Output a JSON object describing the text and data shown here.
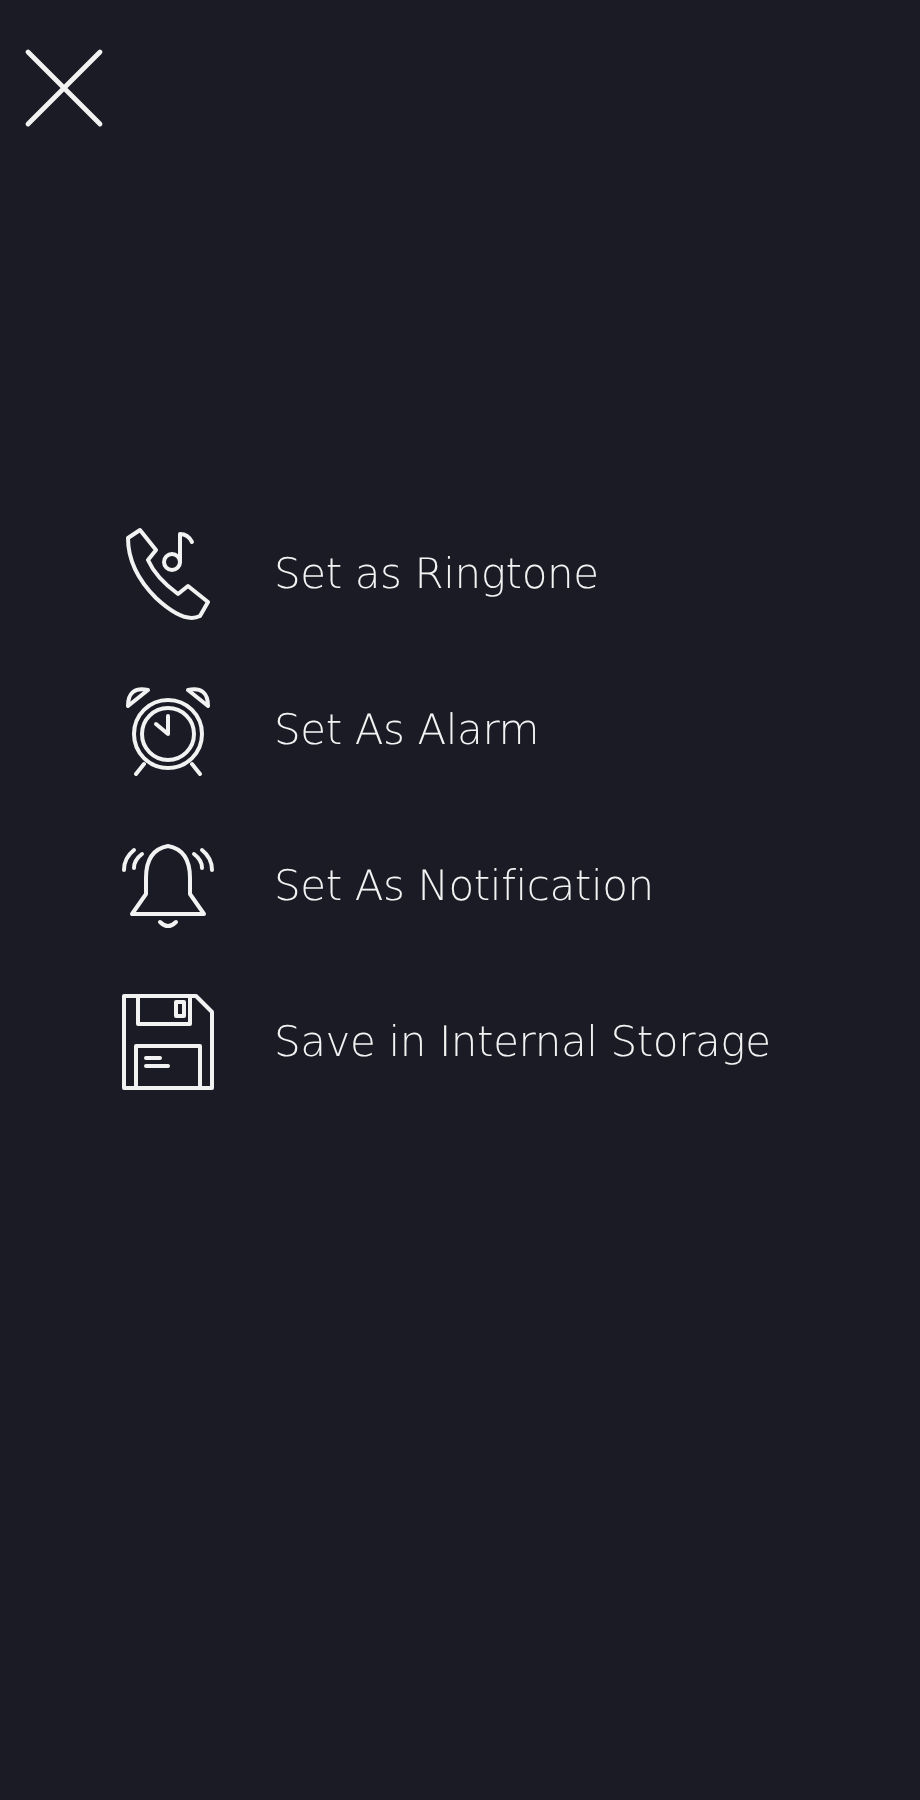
{
  "actions": [
    {
      "kind": "ringtone",
      "label": "Set as Ringtone"
    },
    {
      "kind": "alarm",
      "label": "Set As Alarm"
    },
    {
      "kind": "notification",
      "label": "Set As Notification"
    },
    {
      "kind": "storage",
      "label": "Save in Internal Storage"
    }
  ]
}
